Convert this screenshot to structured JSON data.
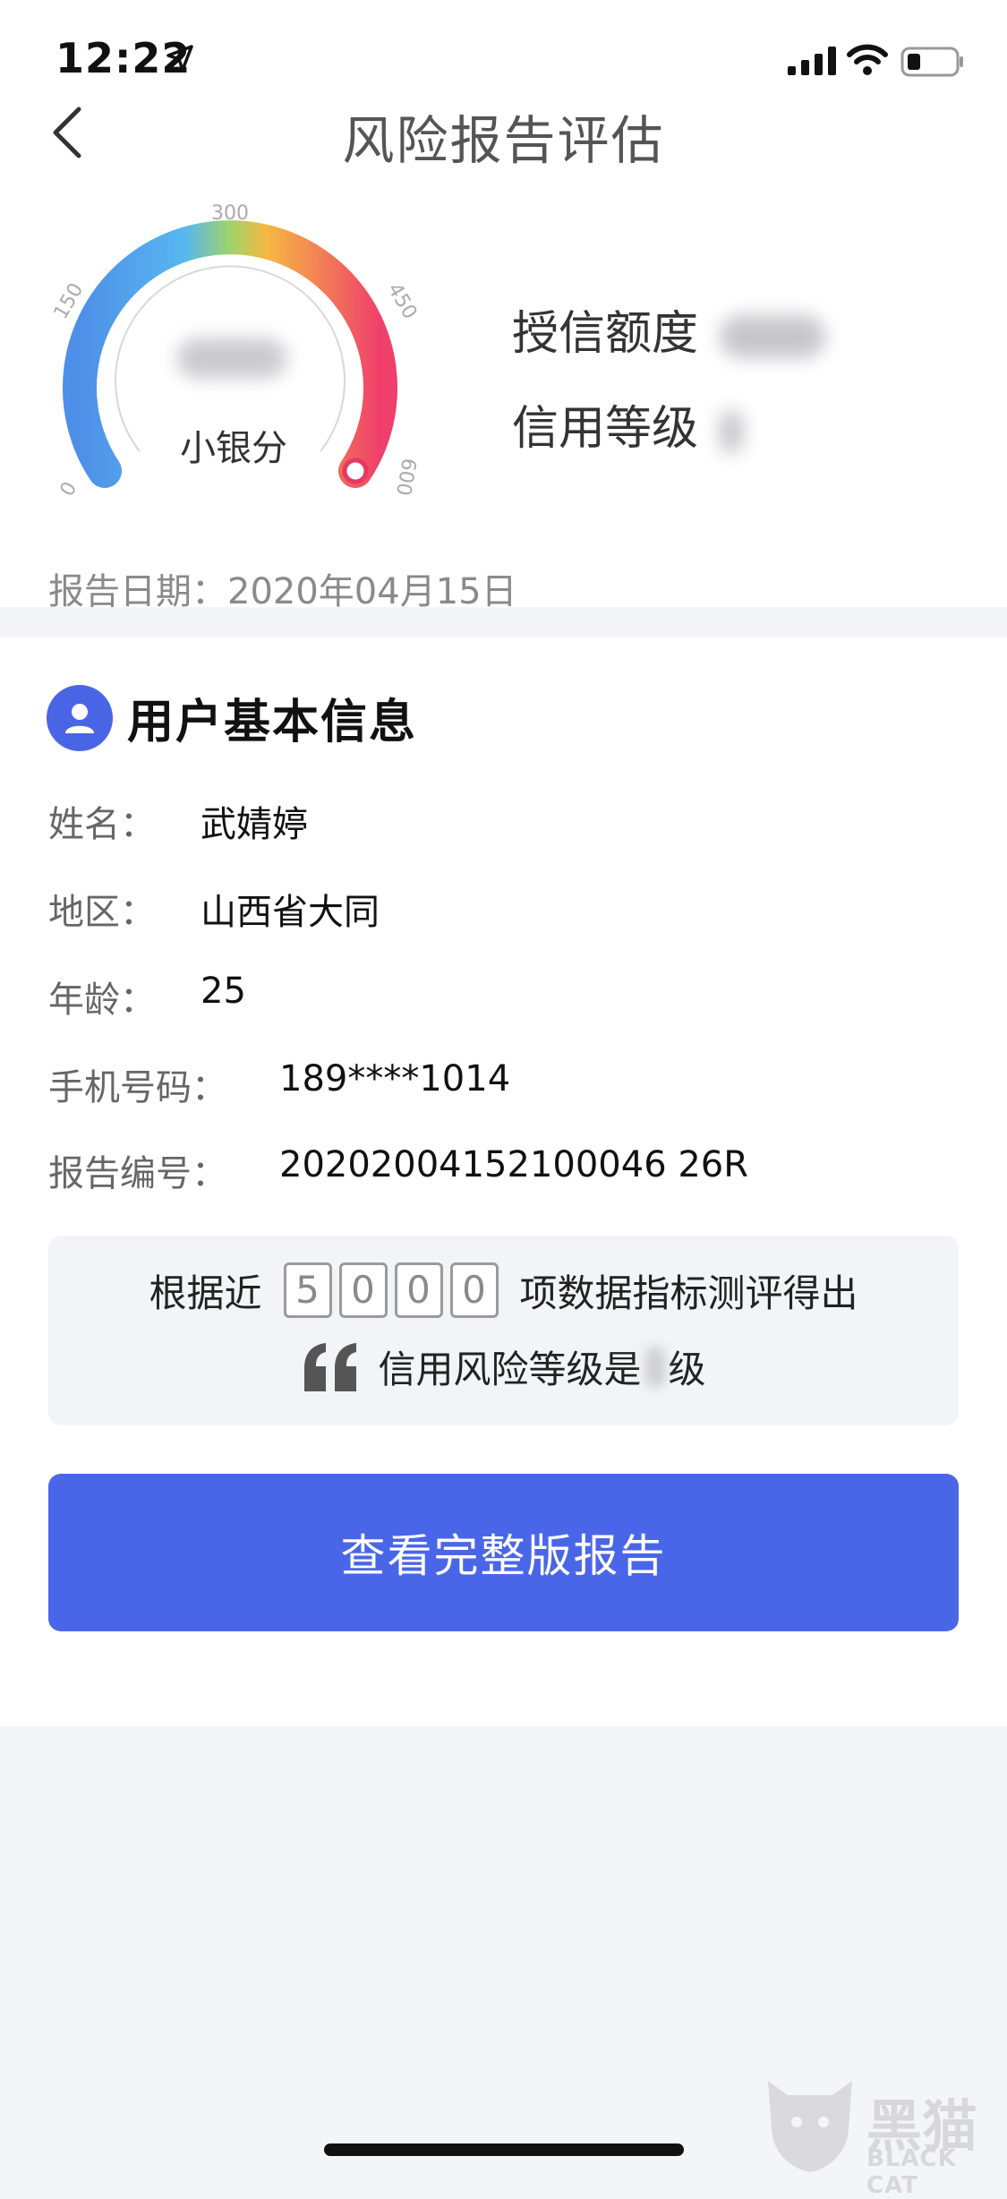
{
  "status_bar": {
    "time": "12:22"
  },
  "header": {
    "title": "风险报告评估"
  },
  "gauge": {
    "label": "小银分",
    "ticks": [
      "0",
      "150",
      "300",
      "450",
      "600"
    ],
    "colors": {
      "start": "#4e8fe8",
      "mid": "#9fd36b",
      "end": "#ef3f6a"
    }
  },
  "credit": {
    "limit_label": "授信额度",
    "level_label": "信用等级"
  },
  "report_date": "报告日期：2020年04月15日",
  "basic_info": {
    "title": "用户基本信息",
    "rows": [
      {
        "label": "姓名：",
        "value": "武婧婷"
      },
      {
        "label": "地区：",
        "value": "山西省大同"
      },
      {
        "label": "年龄：",
        "value": "25"
      },
      {
        "label": "手机号码：",
        "value": "189****1014"
      },
      {
        "label": "报告编号：",
        "value": "20202004152100046 26R"
      }
    ]
  },
  "summary": {
    "prefix": "根据近",
    "digits": [
      "5",
      "0",
      "0",
      "0"
    ],
    "suffix": "项数据指标测评得出",
    "line2_prefix": "信用风险等级是",
    "line2_suffix": "级"
  },
  "cta": {
    "label": "查看完整版报告"
  },
  "watermark": {
    "name": "黑猫",
    "sub": "BLACK CAT"
  },
  "theme": {
    "accent": "#4a66e8"
  }
}
